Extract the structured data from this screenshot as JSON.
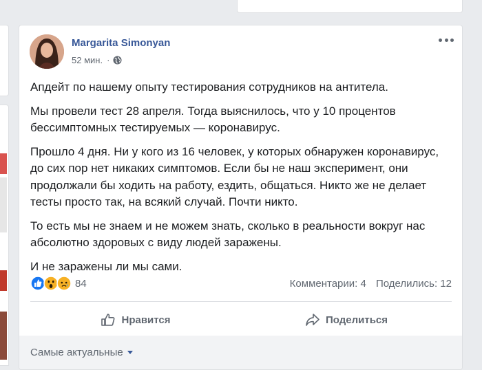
{
  "post": {
    "author": "Margarita Simonyan",
    "time": "52 мин.",
    "privacy_icon": "globe-icon",
    "paragraphs": [
      "Апдейт по нашему опыту тестирования сотрудников на антитела.",
      "Мы провели тест 28 апреля. Тогда выяснилось, что у 10 процентов бессимптомных тестируемых — коронавирус.",
      "Прошло 4 дня. Ни у кого из 16 человек, у которых обнаружен коронавирус, до сих пор нет никаких симптомов. Если бы не наш эксперимент, они продолжали бы ходить на работу, ездить, общаться. Никто же не делает тесты просто так, на всякий случай. Почти никто.",
      "То есть мы не знаем и не можем знать, сколько в реальности вокруг нас абсолютно здоровых с виду людей заражены.",
      "И не заражены ли мы сами."
    ],
    "reactions": {
      "icons": [
        "like-reaction-icon",
        "wow-reaction-icon",
        "sad-reaction-icon"
      ],
      "count": "84"
    },
    "comments_count": "Комментарии: 4",
    "shares_count": "Поделились: 12",
    "actions": {
      "like": "Нравится",
      "share": "Поделиться"
    },
    "comments_sort": "Самые актуальные"
  },
  "colors": {
    "name_link": "#385898",
    "meta": "#606770",
    "like_blue": "#1877f2",
    "emoji_yellow": "#f7b125"
  }
}
